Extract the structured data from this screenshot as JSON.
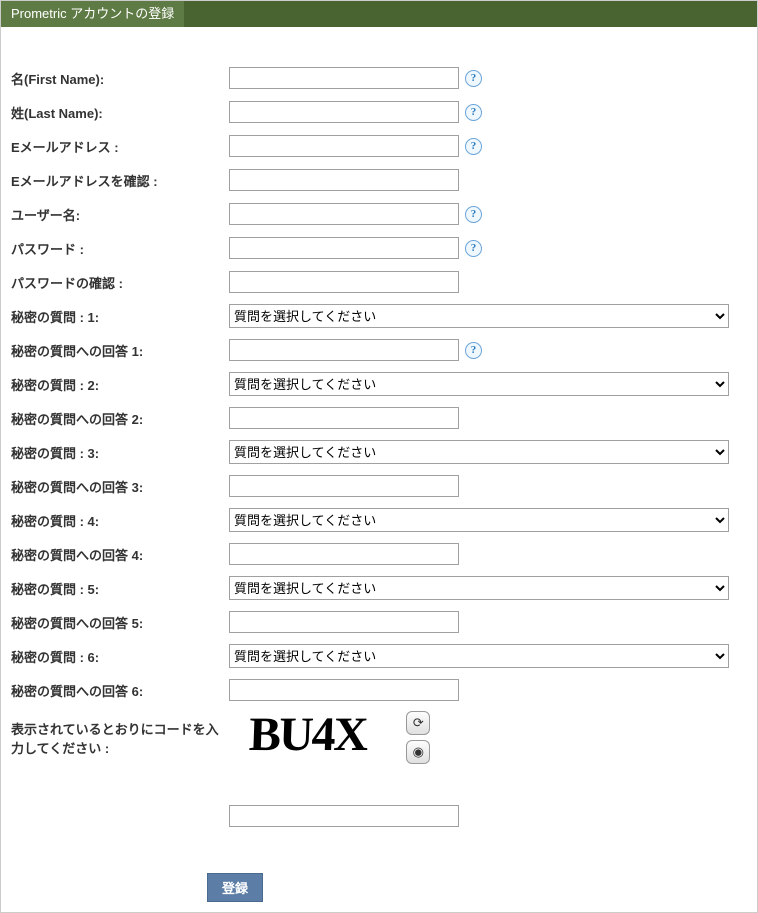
{
  "header": {
    "title": "Prometric アカウントの登録"
  },
  "labels": {
    "firstName": "名(First Name):",
    "lastName": "姓(Last Name):",
    "email": "Eメールアドレス :",
    "emailConfirm": "Eメールアドレスを確認 :",
    "username": "ユーザー名:",
    "password": "パスワード :",
    "passwordConfirm": "パスワードの確認 :",
    "sq1": "秘密の質問 : 1:",
    "sa1": "秘密の質問への回答 1:",
    "sq2": "秘密の質問 : 2:",
    "sa2": "秘密の質問への回答 2:",
    "sq3": "秘密の質問 : 3:",
    "sa3": "秘密の質問への回答 3:",
    "sq4": "秘密の質問 : 4:",
    "sa4": "秘密の質問への回答 4:",
    "sq5": "秘密の質問 : 5:",
    "sa5": "秘密の質問への回答 5:",
    "sq6": "秘密の質問 : 6:",
    "sa6": "秘密の質問への回答 6:",
    "captchaPrompt": "表示されているとおりにコードを入力してください :"
  },
  "selectPlaceholder": "質問を選択してください",
  "captcha": {
    "text": "BU4X"
  },
  "buttons": {
    "submit": "登録"
  }
}
